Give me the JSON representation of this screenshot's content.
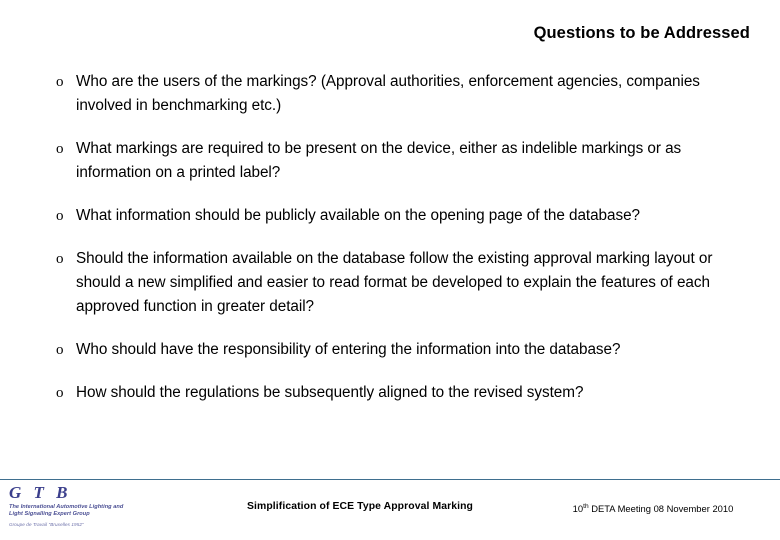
{
  "slide": {
    "title": "Questions to be Addressed",
    "bullet_marker": "o",
    "bullets": [
      {
        "text": "Who are the users of the markings? (Approval authorities, enforcement agencies, companies involved in benchmarking etc.)"
      },
      {
        "text": "What markings are required to be present on the device, either as indelible markings or as information on a printed label?"
      },
      {
        "text": "What information should be publicly available on the opening page of the database?"
      },
      {
        "text": "Should the information available on the database follow the existing approval marking layout or should a new simplified and easier to read format be developed to explain the features of each approved function in greater detail?"
      },
      {
        "text": "Who should have the responsibility of entering the information into the database?"
      },
      {
        "text": "How should the regulations be subsequently aligned to the revised system?"
      }
    ]
  },
  "footer": {
    "logo_word": "G T B",
    "logo_tagline": "The International Automotive Lighting and Light Signalling Expert Group",
    "logo_subnote": "Groupe de Travail  \"Bruxelles 1952\"",
    "center_text": "Simplification of ECE Type Approval Marking",
    "meeting_number": "10",
    "meeting_ordinal_suffix": "th",
    "meeting_text": " DETA Meeting 08 November 2010"
  },
  "colors": {
    "rule": "#3f6f8f",
    "logo": "#3b3f8c",
    "text": "#000000"
  }
}
